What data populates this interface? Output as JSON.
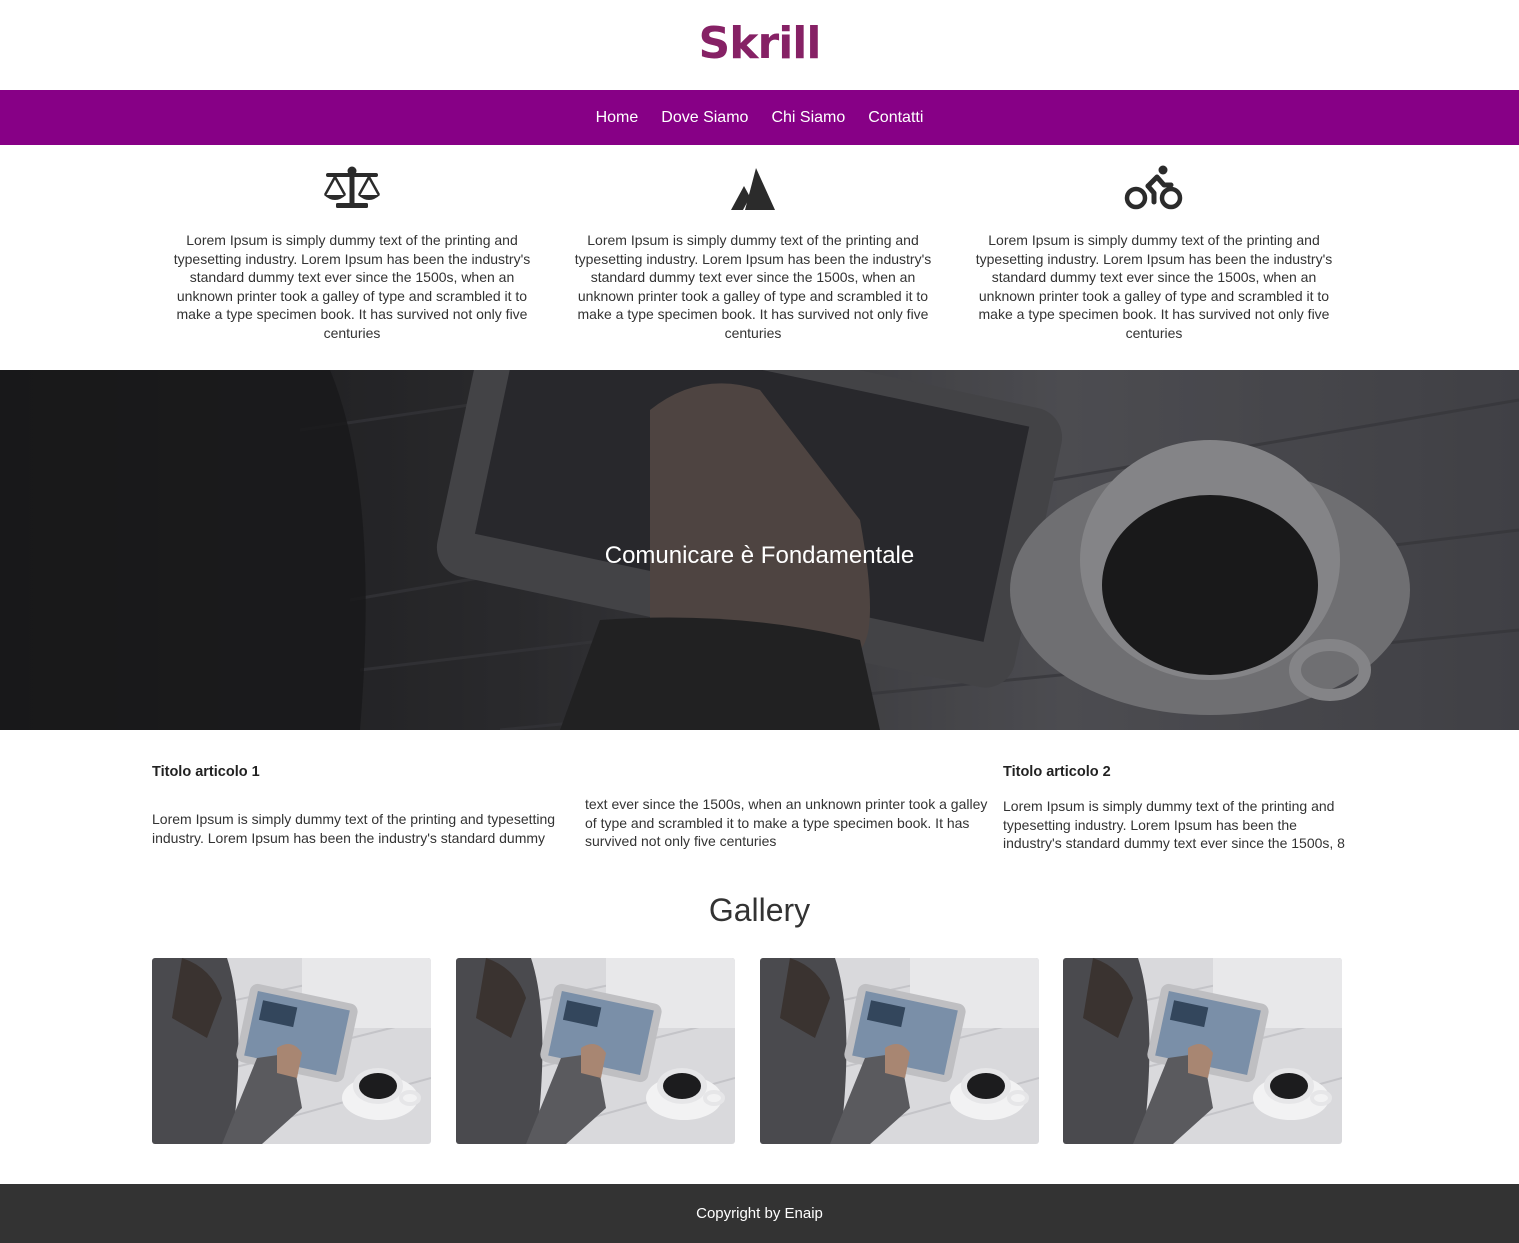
{
  "brand": {
    "logo_text": "Skrill",
    "logo_color": "#862165"
  },
  "colors": {
    "nav_bg": "#870086",
    "footer_bg": "#333333",
    "icon_color": "#2b2b2b"
  },
  "nav": {
    "items": [
      "Home",
      "Dove Siamo",
      "Chi Siamo",
      "Contatti"
    ]
  },
  "features": [
    {
      "icon": "balance-scale-icon",
      "text": "Lorem Ipsum is simply dummy text of the printing and typesetting industry. Lorem Ipsum has been the industry's standard dummy text ever since the 1500s, when an unknown printer took a galley of type and scrambled it to make a type specimen book. It has survived not only five centuries"
    },
    {
      "icon": "mountain-peaks-icon",
      "text": "Lorem Ipsum is simply dummy text of the printing and typesetting industry. Lorem Ipsum has been the industry's standard dummy text ever since the 1500s, when an unknown printer took a galley of type and scrambled it to make a type specimen book. It has survived not only five centuries"
    },
    {
      "icon": "cyclist-icon",
      "text": "Lorem Ipsum is simply dummy text of the printing and typesetting industry. Lorem Ipsum has been the industry's standard dummy text ever since the 1500s, when an unknown printer took a galley of type and scrambled it to make a type specimen book. It has survived not only five centuries"
    }
  ],
  "hero": {
    "title": "Comunicare è Fondamentale"
  },
  "articles": [
    {
      "title": "Titolo articolo 1",
      "text_col1": "Lorem Ipsum is simply dummy text of the printing and typesetting industry. Lorem Ipsum has been the industry's standard dummy",
      "text_col2": "text ever since the 1500s, when an unknown printer took a galley of type and scrambled it to make a type specimen book. It has survived not only five centuries"
    },
    {
      "title": "Titolo articolo 2",
      "text": "Lorem Ipsum is simply dummy text of the printing and typesetting industry. Lorem Ipsum has been the industry's standard dummy text ever since the 1500s, 8"
    }
  ],
  "gallery": {
    "title": "Gallery",
    "image_count": 4
  },
  "footer": {
    "text": "Copyright by Enaip"
  }
}
